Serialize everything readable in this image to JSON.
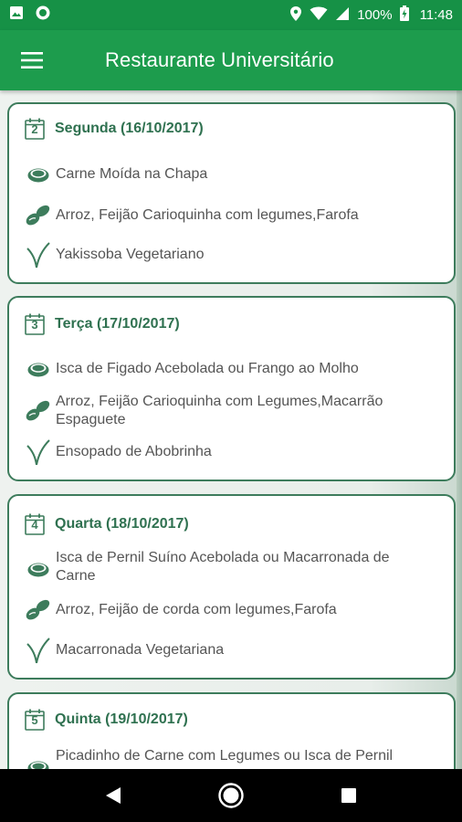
{
  "status_bar": {
    "battery": "100%",
    "time": "11:48"
  },
  "app_bar": {
    "title": "Restaurante Universitário"
  },
  "menu_days": [
    {
      "day_number": "2",
      "label": "Segunda (16/10/2017)",
      "main_dish": "Carne Moída na Chapa",
      "side_dish": "Arroz, Feijão Carioquinha com legumes,Farofa",
      "vegetarian": "Yakissoba Vegetariano"
    },
    {
      "day_number": "3",
      "label": "Terça (17/10/2017)",
      "main_dish": "Isca de Figado Acebolada ou Frango ao Molho",
      "side_dish": "Arroz, Feijão Carioquinha com Legumes,Macarrão Espaguete",
      "vegetarian": "Ensopado de Abobrinha"
    },
    {
      "day_number": "4",
      "label": "Quarta (18/10/2017)",
      "main_dish": "Isca de Pernil Suíno Acebolada ou Macarronada de Carne",
      "side_dish": "Arroz, Feijão de corda com legumes,Farofa",
      "vegetarian": "Macarronada Vegetariana"
    },
    {
      "day_number": "5",
      "label": "Quinta (19/10/2017)",
      "main_dish": "Picadinho de Carne com Legumes ou Isca de Pernil"
    }
  ],
  "icons": {
    "main": "meat-icon",
    "side": "beans-icon",
    "veg": "sprout-icon",
    "calendar": "calendar-icon"
  },
  "colors": {
    "status_bar": "#169146",
    "app_bar": "#1d9c4d",
    "card_border": "#3d7c5c",
    "day_label": "#2f7150"
  }
}
